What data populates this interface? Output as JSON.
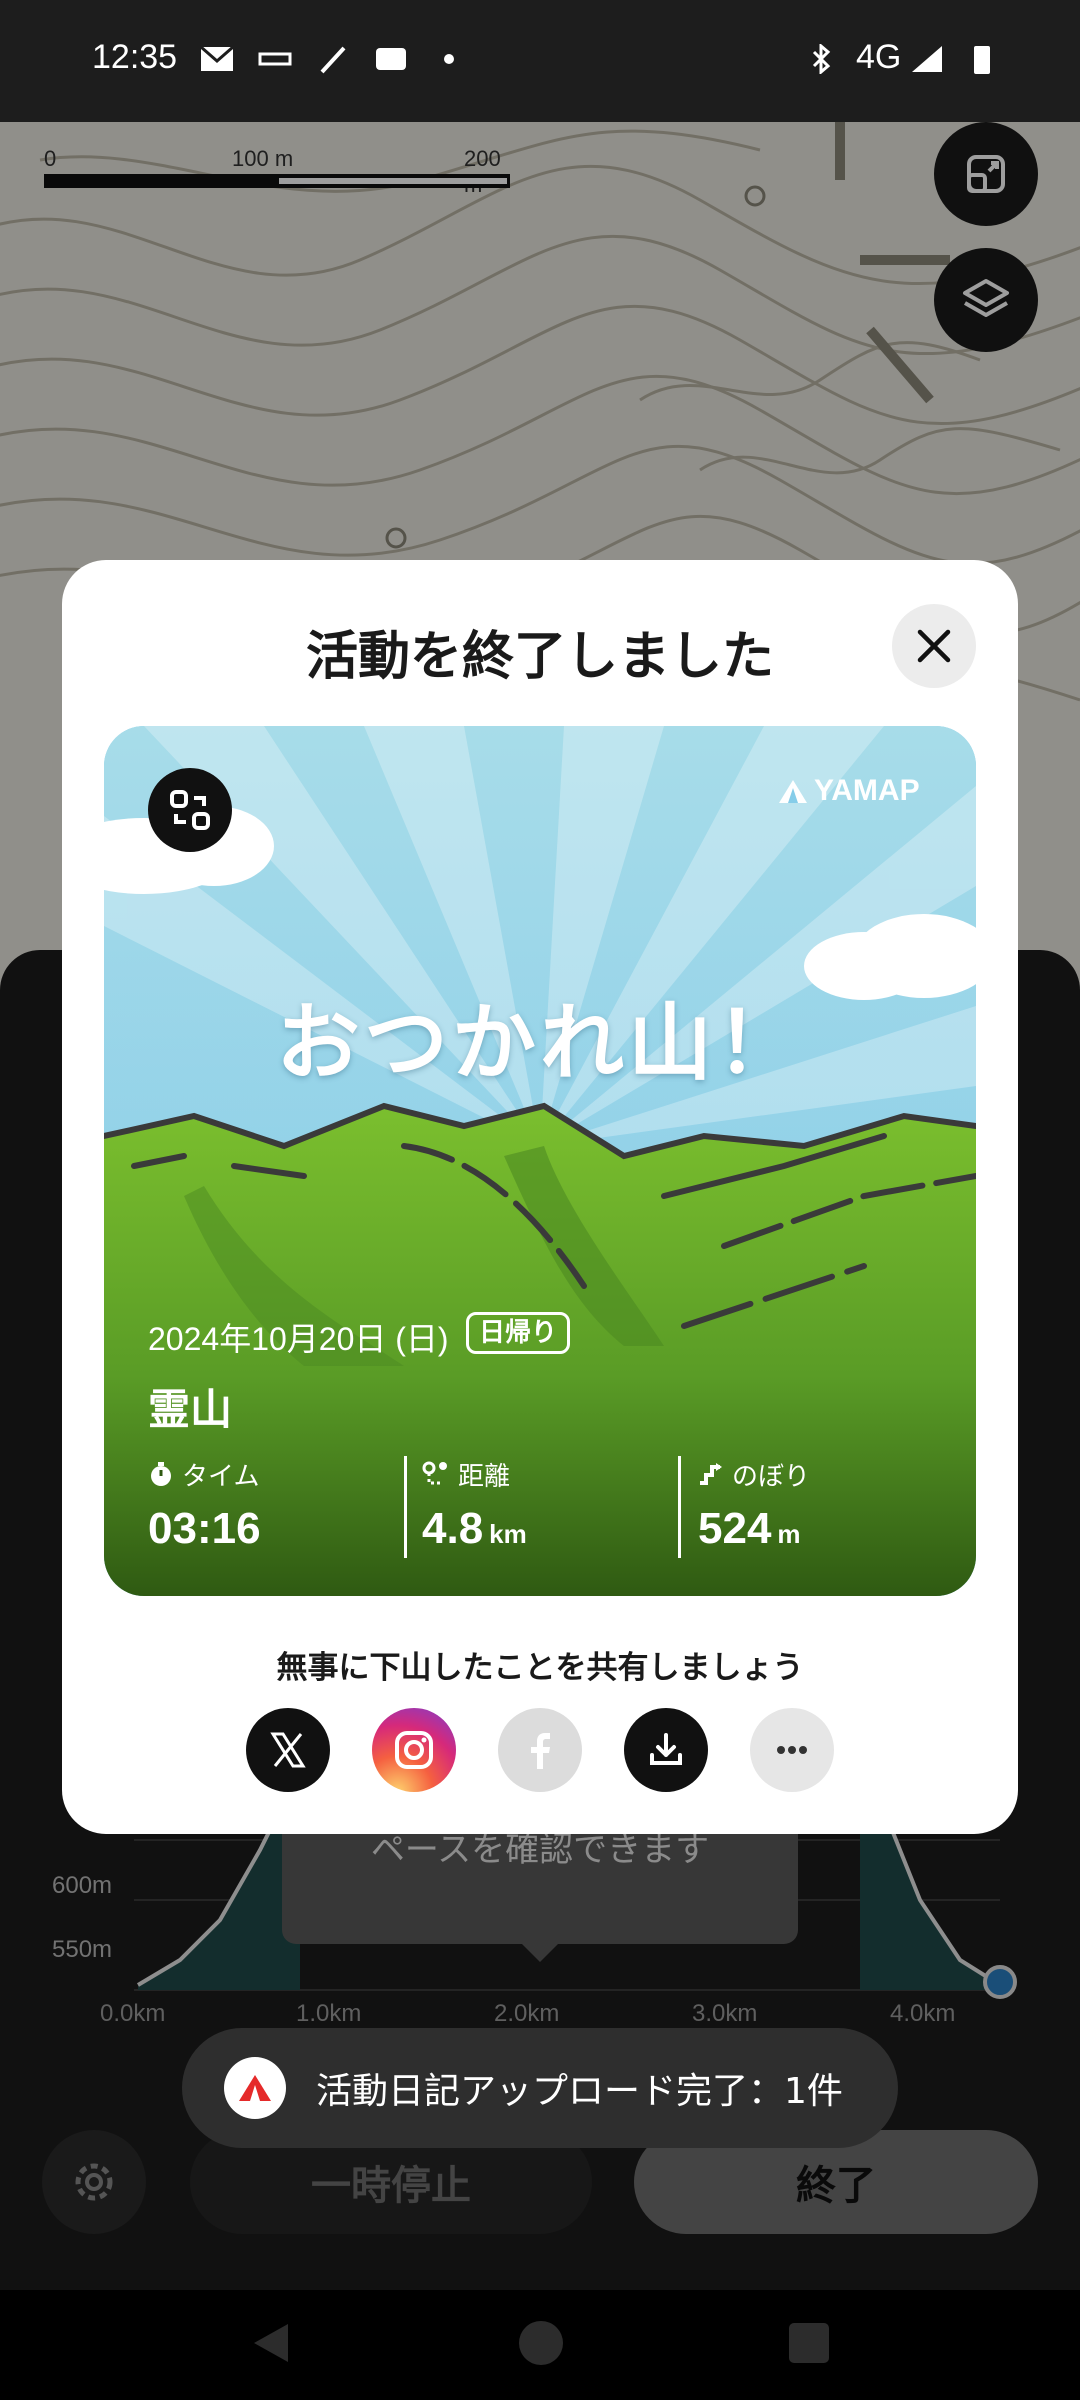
{
  "status_bar": {
    "time": "12:35",
    "network": "4G"
  },
  "map": {
    "scale_labels": [
      "0",
      "100 m",
      "200 m"
    ]
  },
  "modal": {
    "title": "活動を終了しました",
    "card": {
      "brand": "YAMAP",
      "headline": "おつかれ山！",
      "date": "2024年10月20日 (日)",
      "trip_type": "日帰り",
      "mountain": "霊山",
      "stats": [
        {
          "label": "タイム",
          "value": "03:16",
          "unit": ""
        },
        {
          "label": "距離",
          "value": "4.8",
          "unit": "km"
        },
        {
          "label": "のぼり",
          "value": "524",
          "unit": "m"
        }
      ]
    },
    "share_text": "無事に下山したことを共有しましょう",
    "share_targets": [
      "x-icon",
      "instagram-icon",
      "facebook-icon",
      "download-icon",
      "more-icon"
    ]
  },
  "elevation": {
    "y_ticks": [
      "600m",
      "550m"
    ],
    "x_ticks": [
      "0.0km",
      "1.0km",
      "2.0km",
      "3.0km",
      "4.0km"
    ]
  },
  "tooltip": {
    "text": "ペースを確認できます"
  },
  "toast": {
    "text": "活動日記アップロード完了：1件"
  },
  "controls": {
    "pause": "一時停止",
    "finish": "終了"
  },
  "colors": {
    "accent": "#e52a2a",
    "card_sky": "#86cde9",
    "card_grass": "#6db52a",
    "instagram": "#d6297a"
  }
}
